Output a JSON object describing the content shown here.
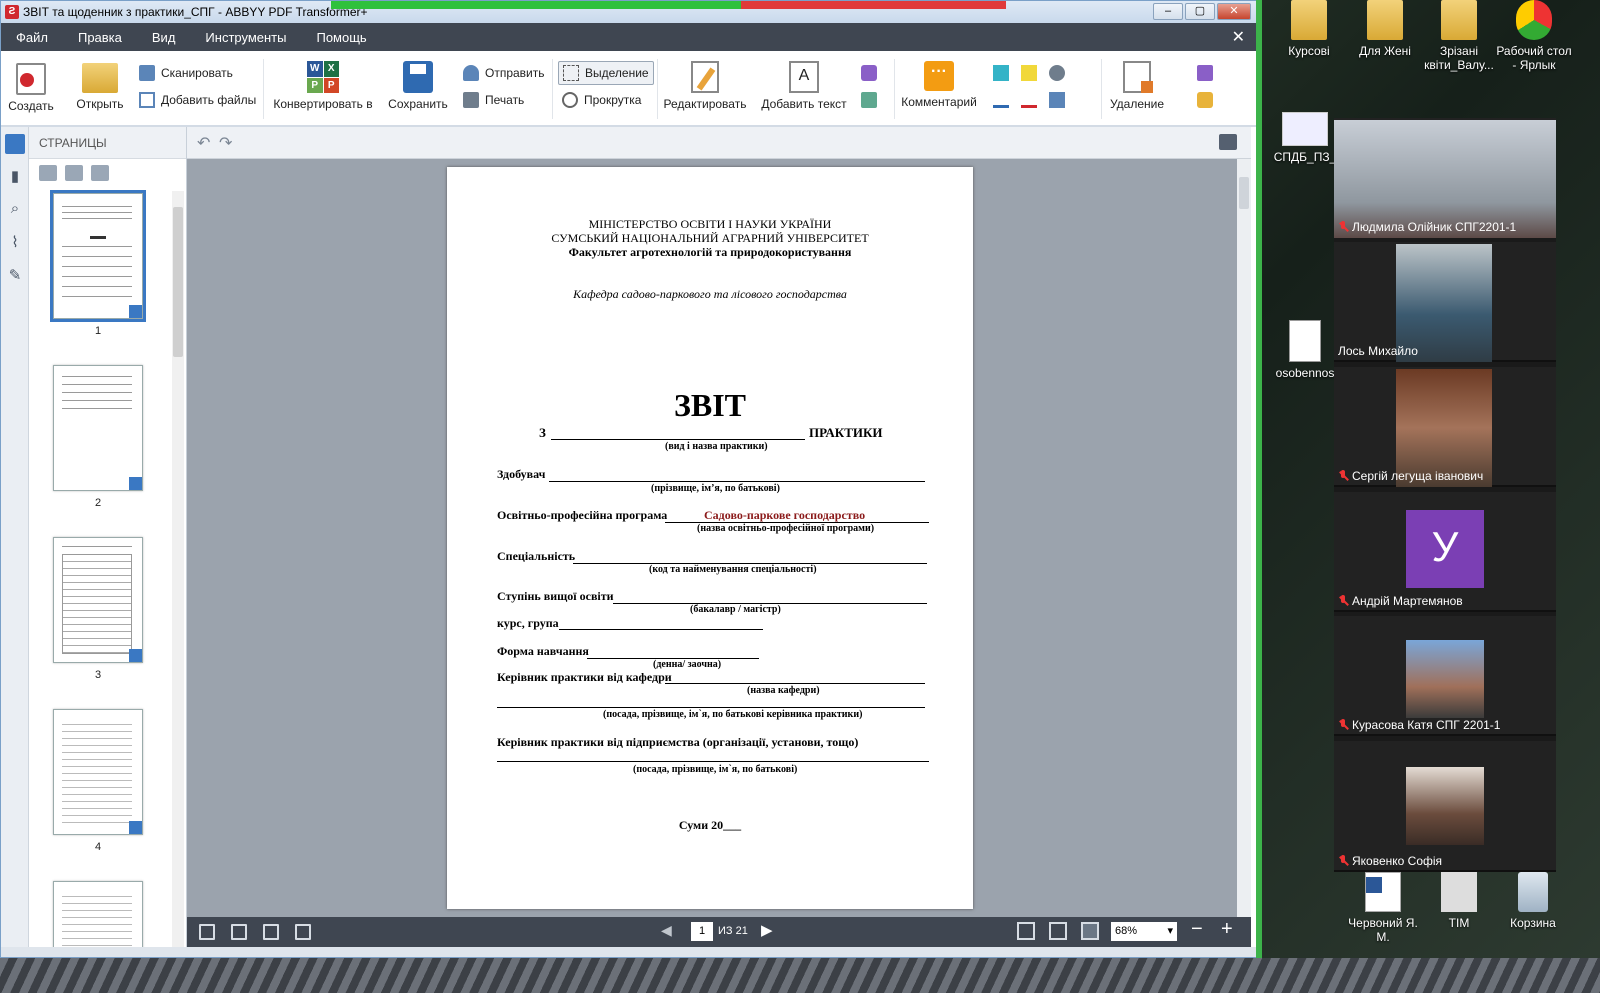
{
  "window": {
    "title": "ЗВІТ та щоденник з практики_СПГ - ABBYY PDF Transformer+",
    "app_icon": "abbyy-icon",
    "buttons": {
      "minimize": "‒",
      "maximize": "▢",
      "close": "✕"
    }
  },
  "menu": {
    "items": [
      "Файл",
      "Правка",
      "Вид",
      "Инструменты",
      "Помощь"
    ],
    "close": "✕"
  },
  "ribbon": {
    "create": "Создать",
    "open": "Открыть",
    "scan": "Сканировать",
    "add_files": "Добавить файлы",
    "convert": "Конвертировать в",
    "save": "Сохранить",
    "send": "Отправить",
    "print": "Печать",
    "select": "Выделение",
    "pan": "Прокрутка",
    "edit": "Редактировать",
    "add_text": "Добавить текст",
    "comment": "Комментарий",
    "delete": "Удаление",
    "convert_letters": [
      "W",
      "X",
      "P",
      "P"
    ]
  },
  "pages_pane": {
    "title": "СТРАНИЦЫ",
    "pages": [
      "1",
      "2",
      "3",
      "4"
    ]
  },
  "document": {
    "ministry": "МІНІСТЕРСТВО ОСВІТИ І НАУКИ УКРАЇНИ",
    "university": "СУМСЬКИЙ НАЦІОНАЛЬНИЙ АГРАРНИЙ УНІВЕРСИТЕТ",
    "faculty": "Факультет агротехнологій та природокористування",
    "department": "Кафедра садово-паркового та лісового господарства",
    "heading": "ЗВІТ",
    "practice_prefix": "З",
    "practice_suffix": "ПРАКТИКИ",
    "practice_hint": "(вид і назва практики)",
    "student_label": "Здобувач",
    "student_hint": "(прізвище, ім’я, по батькові)",
    "program_label": "Освітньо-професійна програма",
    "program_value": "Садово-паркове господарство",
    "program_hint": "(назва освітньо-професійної програми)",
    "specialty_label": "Спеціальність",
    "specialty_hint": "(код та найменування спеціальності)",
    "degree_label": "Ступінь вищої освіти",
    "degree_hint": "(бакалавр / магістр)",
    "course_label": "курс, група",
    "form_label": "Форма навчання",
    "form_hint": "(денна/ заочна)",
    "supervisor_dept_label": "Керівник практики від кафедри",
    "supervisor_dept_hint": "(назва кафедри)",
    "supervisor_dept_hint2": "(посада, прізвище, ім`я, по батькові керівника практики)",
    "supervisor_org_label": "Керівник практики від підприємства (організації, установи, тощо)",
    "supervisor_org_hint": "(посада, прізвище, ім`я, по батькові)",
    "city_year": "Суми 20___"
  },
  "statusbar": {
    "page": "1",
    "total": "ИЗ 21",
    "zoom": "68%",
    "prev": "◀",
    "next": "▶",
    "minus": "−",
    "plus": "+"
  },
  "desktop": {
    "icons": [
      "Курсові",
      "Для Жені",
      "Зрізані квіти_Валу...",
      "Рабочий стол - Ярлык",
      "СПДБ_ПЗ_",
      "osobennos",
      "Червоний Я. М.",
      "ТІМ",
      "Корзина"
    ]
  },
  "participants": [
    {
      "name": "Людмила Олійник СПГ2201-1"
    },
    {
      "name": "Лось Михайло"
    },
    {
      "name": "Сергій легуща іванович"
    },
    {
      "name": "Андрій Мартемянов",
      "avatar": "У"
    },
    {
      "name": "Курасова Катя СПГ 2201-1"
    },
    {
      "name": "Яковенко Софія"
    }
  ],
  "colors": {
    "program_value": "#8b1a1a",
    "menu_bg": "#3f4651",
    "avatar_bg": "#7b3fb4",
    "accent": "#3a78c3"
  }
}
